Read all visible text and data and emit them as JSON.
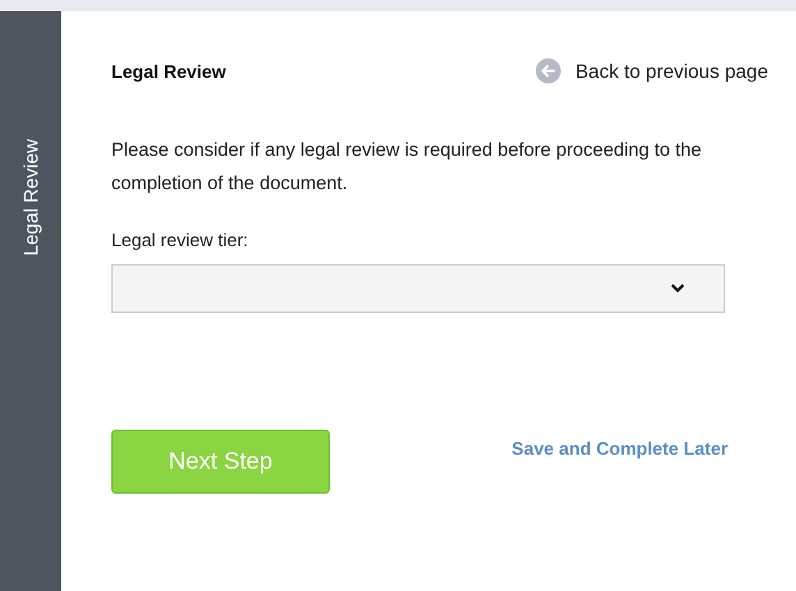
{
  "sidebar": {
    "title": "Legal Review"
  },
  "header": {
    "title": "Legal Review",
    "back_link": "Back to previous page"
  },
  "intro": "Please consider if any legal review is required before proceeding to the completion of the document.",
  "form": {
    "label": "Legal review tier:"
  },
  "actions": {
    "primary": "Next Step",
    "secondary": "Save and Complete Later"
  }
}
